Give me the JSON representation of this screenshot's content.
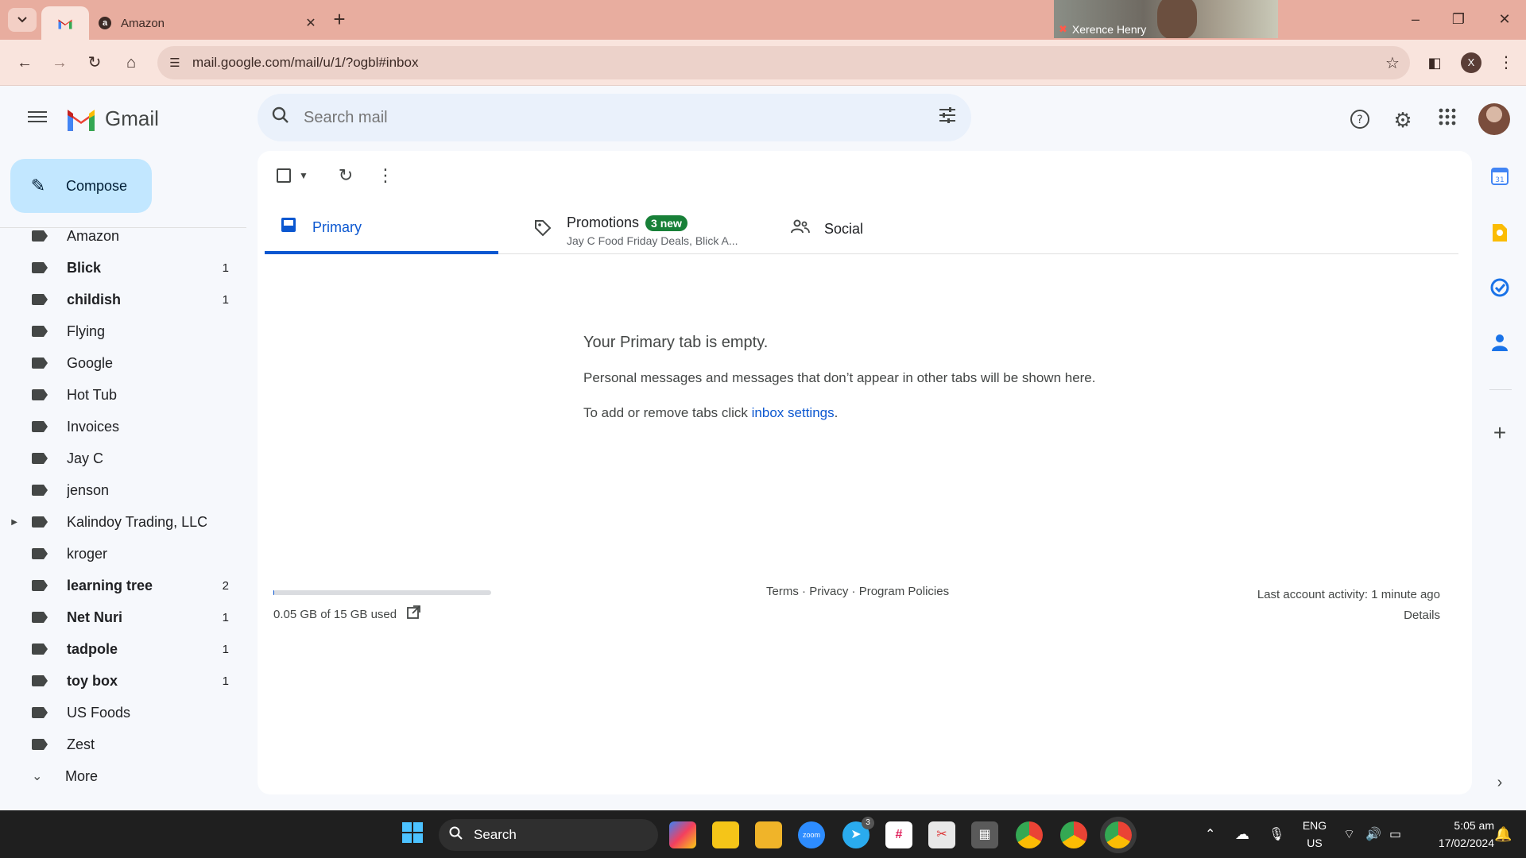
{
  "browser": {
    "tabs": [
      {
        "title": "",
        "favicon": "gmail-icon",
        "active": true
      },
      {
        "title": "Amazon",
        "favicon": "amazon-icon",
        "active": false
      }
    ],
    "url": "mail.google.com/mail/u/1/?ogbl#inbox",
    "profile_initial": "X",
    "video_call_name": "Xerence Henry",
    "theme_color": "#e8ad9f"
  },
  "gmail": {
    "app_name": "Gmail",
    "search_placeholder": "Search mail",
    "compose_label": "Compose",
    "labels": [
      {
        "name": "Amazon",
        "count": "",
        "bold": false
      },
      {
        "name": "Blick",
        "count": "1",
        "bold": true
      },
      {
        "name": "childish",
        "count": "1",
        "bold": true
      },
      {
        "name": "Flying",
        "count": "",
        "bold": false
      },
      {
        "name": "Google",
        "count": "",
        "bold": false
      },
      {
        "name": "Hot Tub",
        "count": "",
        "bold": false
      },
      {
        "name": "Invoices",
        "count": "",
        "bold": false
      },
      {
        "name": "Jay C",
        "count": "",
        "bold": false
      },
      {
        "name": "jenson",
        "count": "",
        "bold": false
      },
      {
        "name": "Kalindoy Trading, LLC - ...",
        "count": "",
        "bold": false,
        "expandable": true
      },
      {
        "name": "kroger",
        "count": "",
        "bold": false
      },
      {
        "name": "learning tree",
        "count": "2",
        "bold": true
      },
      {
        "name": "Net Nuri",
        "count": "1",
        "bold": true
      },
      {
        "name": "tadpole",
        "count": "1",
        "bold": true
      },
      {
        "name": "toy box",
        "count": "1",
        "bold": true
      },
      {
        "name": "US Foods",
        "count": "",
        "bold": false
      },
      {
        "name": "Zest",
        "count": "",
        "bold": false
      }
    ],
    "more_label": "More",
    "inbox_tabs": {
      "primary": "Primary",
      "promotions": "Promotions",
      "promotions_badge": "3 new",
      "promotions_snippet": "Jay C Food Friday Deals, Blick A...",
      "social": "Social"
    },
    "empty_state": {
      "title": "Your Primary tab is empty.",
      "line1": "Personal messages and messages that don’t appear in other tabs will be shown here.",
      "line2_prefix": "To add or remove tabs click ",
      "line2_link": "inbox settings",
      "line2_suffix": "."
    },
    "storage": {
      "text": "0.05 GB of 15 GB used",
      "used_fraction": 0.003
    },
    "footer": {
      "terms": "Terms",
      "privacy": "Privacy",
      "policies": "Program Policies",
      "separator": " · "
    },
    "activity": {
      "text": "Last account activity: 1 minute ago",
      "details": "Details"
    },
    "accent_color": "#0b57d0",
    "compose_color": "#c2e7ff",
    "badge_color": "#188038"
  },
  "taskbar": {
    "search_label": "Search",
    "lang_line1": "ENG",
    "lang_line2": "US",
    "time": "5:05 am",
    "date": "17/02/2024",
    "telegram_badge": "3"
  }
}
